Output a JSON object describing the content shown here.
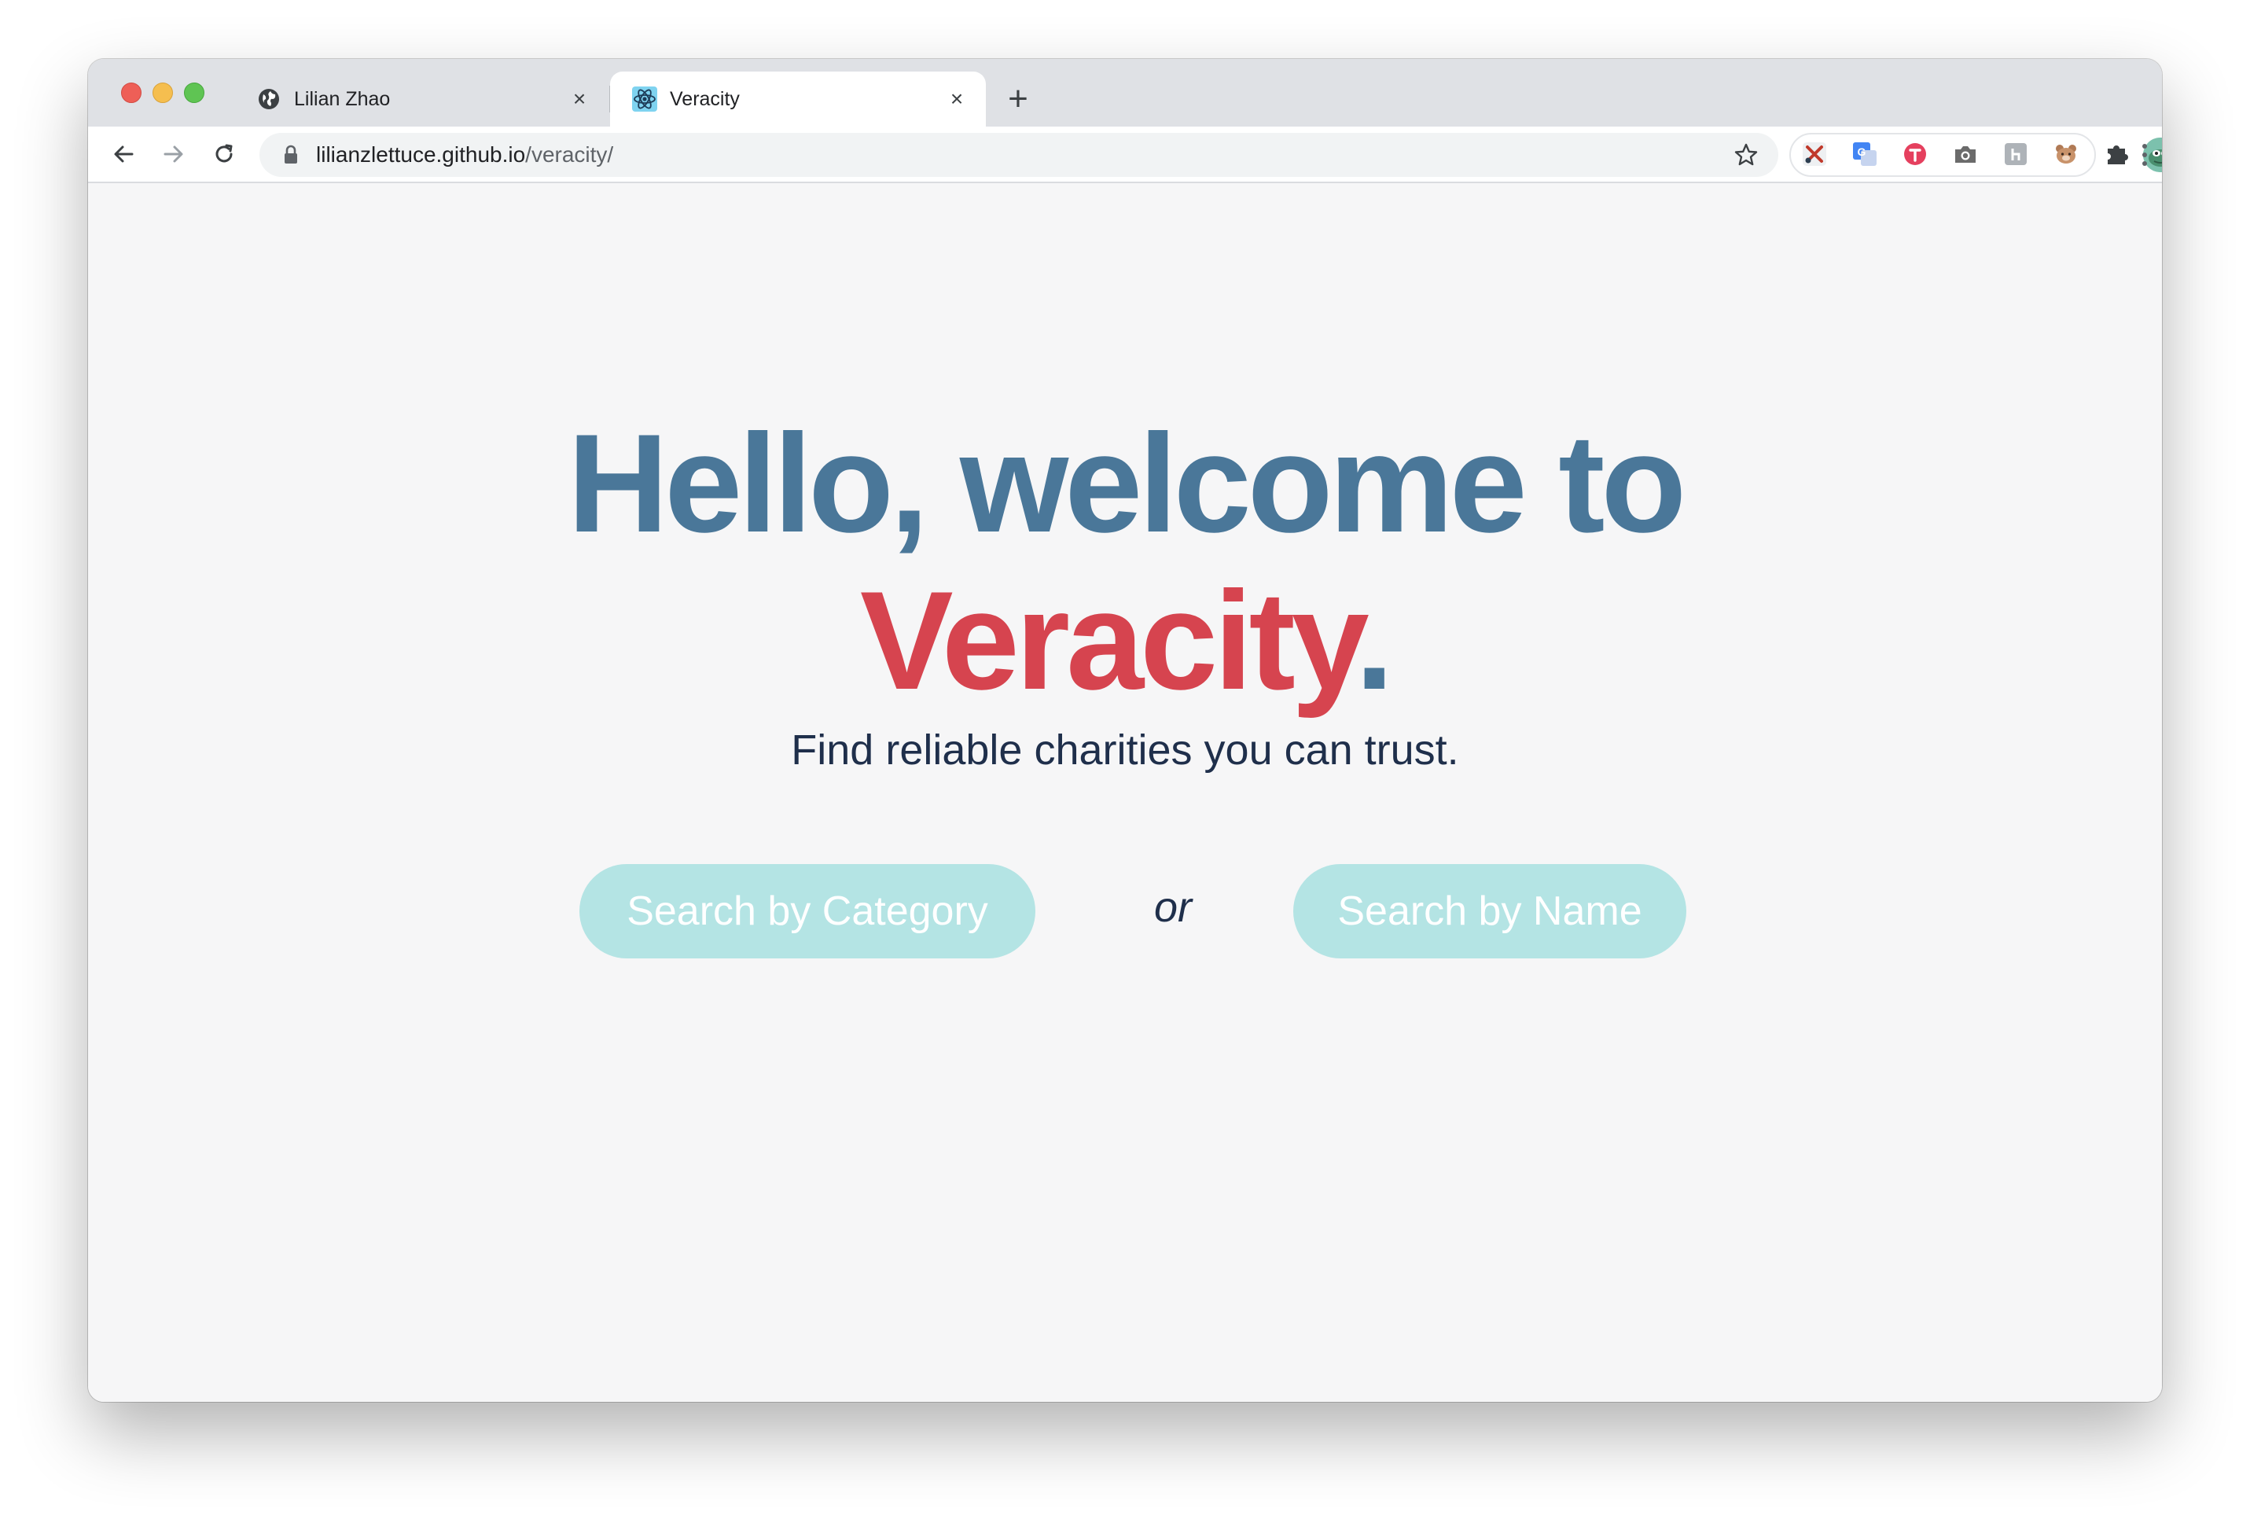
{
  "browser": {
    "tabs": [
      {
        "title": "Lilian Zhao",
        "icon": "globe-icon",
        "active": false
      },
      {
        "title": "Veracity",
        "icon": "react-icon",
        "active": true
      }
    ],
    "new_tab_label": "+",
    "close_glyph": "×",
    "url_host": "lilianzlettuce.github.io",
    "url_path": "/veracity/"
  },
  "extensions": [
    {
      "name": "scissors-extension-icon",
      "color": "#c0392b"
    },
    {
      "name": "translate-extension-icon",
      "color": "#4285f4"
    },
    {
      "name": "red-circle-extension-icon",
      "color": "#e5405e"
    },
    {
      "name": "camera-extension-icon",
      "color": "#6b6b6b"
    },
    {
      "name": "grey-square-extension-icon",
      "color": "#9aa0a6"
    },
    {
      "name": "bear-extension-icon",
      "color": "#b07a55"
    },
    {
      "name": "puzzle-extensions-icon",
      "color": "#5f6368"
    }
  ],
  "page": {
    "heading_line1": "Hello, welcome to",
    "heading_brand": "Veracity",
    "heading_period": ".",
    "tagline": "Find reliable charities you can trust.",
    "search_category_label": "Search by Category",
    "or_label": "or",
    "search_name_label": "Search by Name"
  },
  "colors": {
    "heading_blue": "#4a7799",
    "brand_red": "#d6444f",
    "button_teal": "#b4e4e4",
    "text_navy": "#1f2f4b"
  }
}
